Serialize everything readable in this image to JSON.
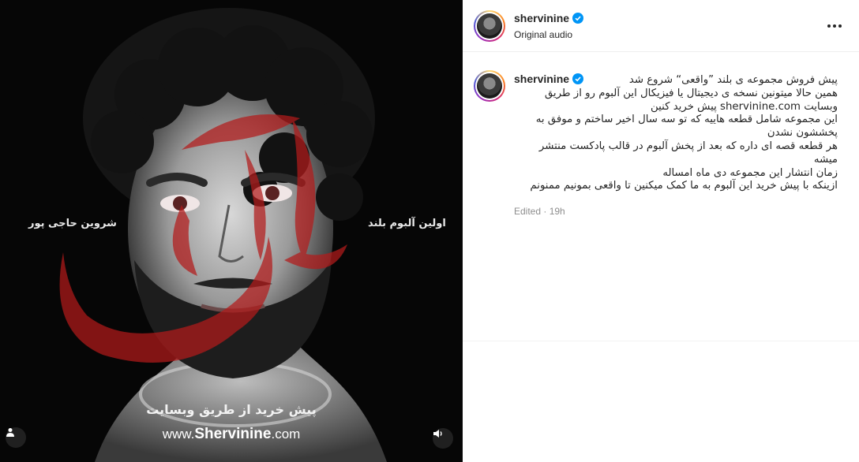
{
  "media": {
    "text_right": "اولین آلبوم بلند",
    "text_left": "شروین حاجی پور",
    "bottom_text": "پیش خرید از طریق وبسایت",
    "url_prefix": "www.",
    "url_brand": "Shervinine",
    "url_suffix": ".com",
    "accent_color": "#b31b1b",
    "user_icon": "user-icon",
    "audio_icon": "speaker-icon"
  },
  "post": {
    "username": "shervinine",
    "audio": "Original audio",
    "more_icon": "more-icon",
    "verified_icon": "verified-badge-icon"
  },
  "caption": {
    "username": "shervinine",
    "lines": [
      "پیش فروش مجموعه ی بلند ”واقعی“ شروع شد",
      "همین حالا میتونین نسخه ی دیجیتال یا فیزیکال این آلبوم رو از طریق",
      "وبسایت shervinine.com پیش خرید کنین",
      "این مجموعه شامل قطعه هاییه که تو سه سال اخیر ساختم و موفق به",
      "پخششون نشدن",
      "هر قطعه قصه ای داره که بعد از پخش آلبوم در قالب پادکست منتشر",
      "میشه",
      "زمان انتشار این مجموعه دی ماه امساله",
      "ازینکه با پیش خرید این آلبوم به ما کمک میکنین تا واقعی بمونیم ممنونم"
    ],
    "edited": "Edited",
    "time": "19h"
  }
}
